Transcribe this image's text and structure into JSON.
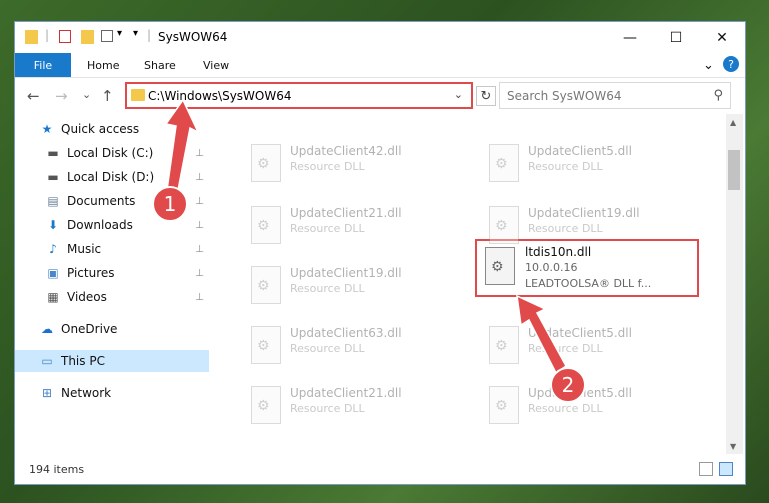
{
  "window": {
    "title": "SysWOW64"
  },
  "titlebar": {
    "minimize_glyph": "—",
    "maximize_glyph": "☐",
    "close_glyph": "✕",
    "qa_dropdown_glyph": "▾"
  },
  "ribbon": {
    "tabs": [
      "File",
      "Home",
      "Share",
      "View"
    ],
    "expand_glyph": "⌄",
    "help_glyph": "?"
  },
  "nav": {
    "back_glyph": "←",
    "forward_glyph": "→",
    "recent_glyph": "⌄",
    "up_glyph": "↑",
    "address": "C:\\Windows\\SysWOW64",
    "address_chevron": "⌄",
    "refresh_glyph": "↻",
    "search_placeholder": "Search SysWOW64",
    "search_glyph": "⚲"
  },
  "sidebar": {
    "items": [
      {
        "label": "Quick access",
        "icon": "star-icon",
        "glyph": "★",
        "color": "#1979ca",
        "pinned": false
      },
      {
        "label": "Local Disk (C:)",
        "icon": "drive-icon",
        "glyph": "▬",
        "color": "#555555",
        "pinned": true
      },
      {
        "label": "Local Disk (D:)",
        "icon": "drive-icon",
        "glyph": "▬",
        "color": "#555555",
        "pinned": true
      },
      {
        "label": "Documents",
        "icon": "documents-icon",
        "glyph": "▤",
        "color": "#6a7f99",
        "pinned": true
      },
      {
        "label": "Downloads",
        "icon": "downloads-icon",
        "glyph": "⬇",
        "color": "#1979ca",
        "pinned": true
      },
      {
        "label": "Music",
        "icon": "music-icon",
        "glyph": "♪",
        "color": "#1979ca",
        "pinned": true
      },
      {
        "label": "Pictures",
        "icon": "pictures-icon",
        "glyph": "▣",
        "color": "#4a86c8",
        "pinned": true
      },
      {
        "label": "Videos",
        "icon": "videos-icon",
        "glyph": "▦",
        "color": "#555555",
        "pinned": true
      },
      {
        "label": "OneDrive",
        "icon": "cloud-icon",
        "glyph": "☁",
        "color": "#1e6fd0",
        "pinned": false
      },
      {
        "label": "This PC",
        "icon": "computer-icon",
        "glyph": "▭",
        "color": "#4a86c8",
        "pinned": false,
        "selected": true
      },
      {
        "label": "Network",
        "icon": "network-icon",
        "glyph": "⊞",
        "color": "#4a86c8",
        "pinned": false
      }
    ],
    "pin_glyph": "📌"
  },
  "files": [
    {
      "name": "UpdateClient42.dll",
      "desc": "Resource DLL"
    },
    {
      "name": "UpdateClient5.dll",
      "desc": "Resource DLL"
    },
    {
      "name": "UpdateClient21.dll",
      "desc": "Resource DLL"
    },
    {
      "name": "UpdateClient19.dll",
      "desc": "Resource DLL"
    },
    {
      "name": "UpdateClient19.dll",
      "desc": "Resource DLL"
    },
    {
      "name": "UpdateClient63.dll",
      "desc": "Resource DLL"
    },
    {
      "name": "UpdateClient5.dll",
      "desc": "Resource DLL"
    },
    {
      "name": "UpdateClient21.dll",
      "desc": "Resource DLL"
    },
    {
      "name": "UpdateClient5.dll",
      "desc": "Resource DLL"
    }
  ],
  "highlighted_file": {
    "name": "ltdis10n.dll",
    "version": "10.0.0.16",
    "desc": "LEADTOOLSA® DLL f..."
  },
  "status": {
    "item_count": "194 items"
  },
  "annotations": {
    "badge1": "1",
    "badge2": "2",
    "accent": "#e04a4a"
  },
  "colors": {
    "file_tab": "#1979ca",
    "selected_bg": "#cce8ff",
    "highlight_border": "#e04a4a"
  }
}
